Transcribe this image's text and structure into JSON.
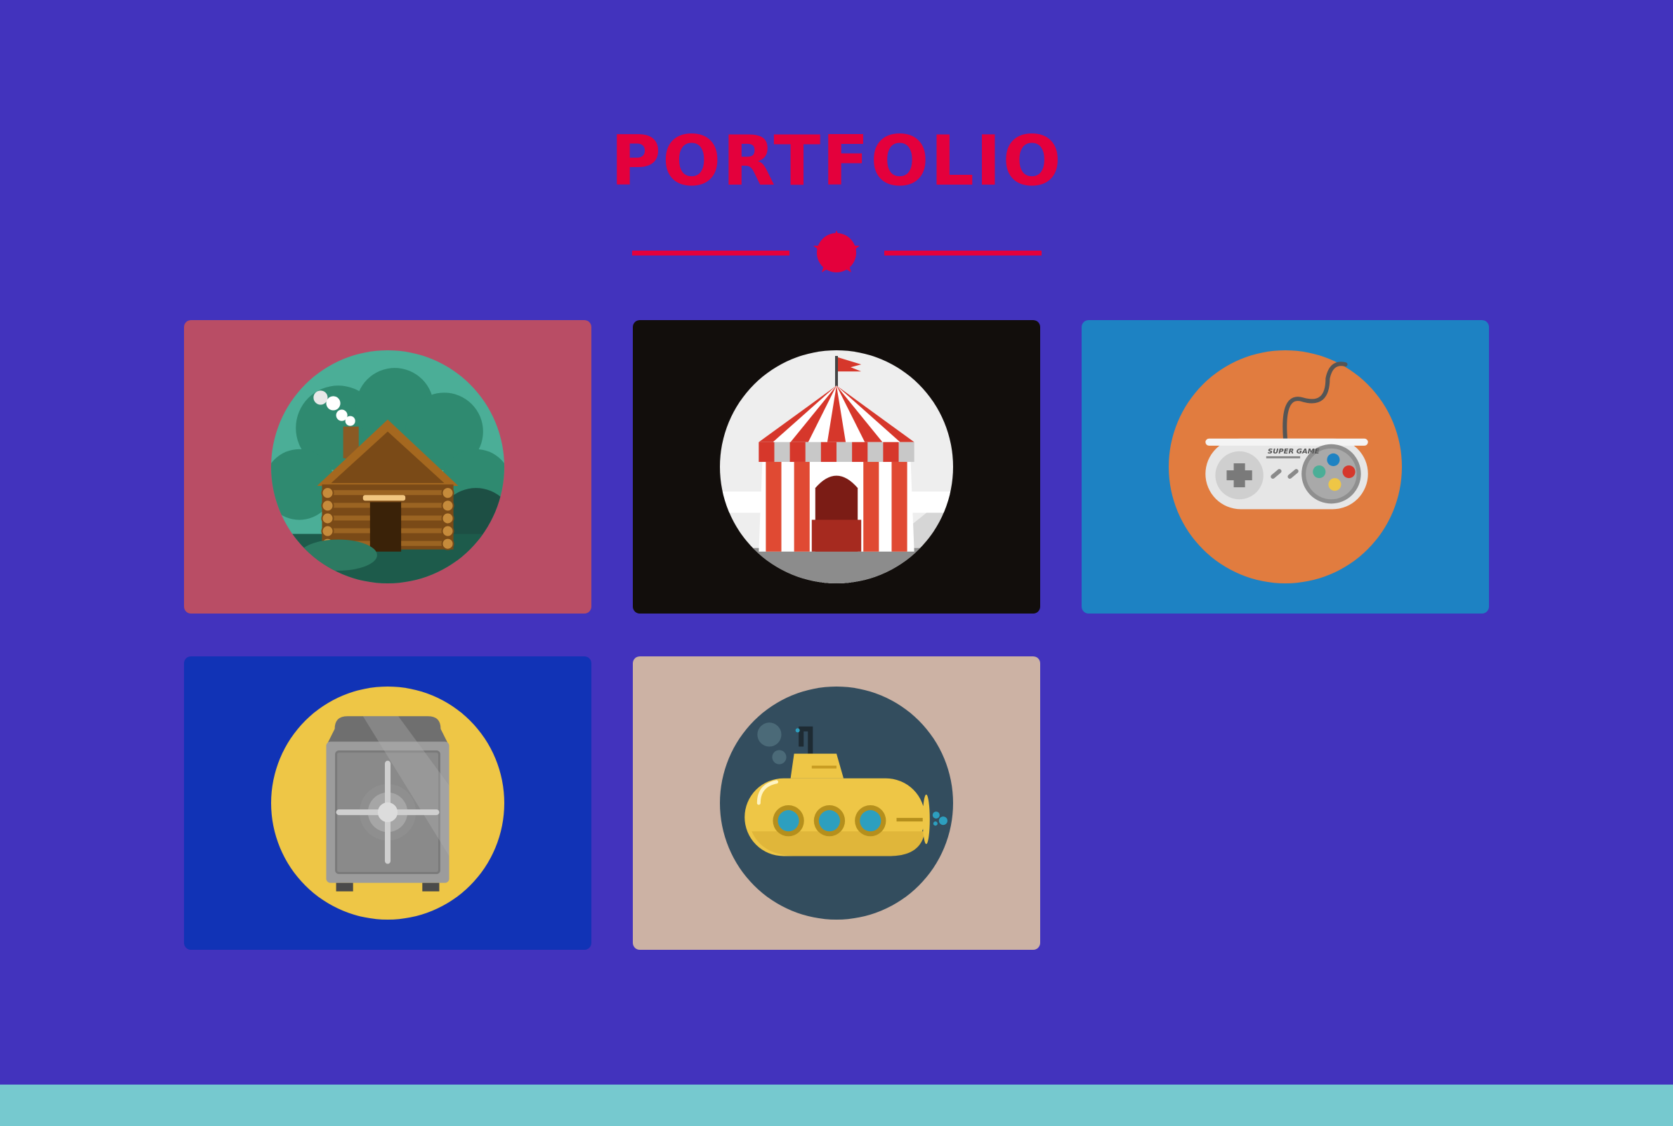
{
  "page": {
    "background": "#4233bd"
  },
  "header": {
    "title": "PORTFOLIO",
    "title_color": "#e4003c",
    "divider_icon": "star-icon"
  },
  "portfolio": {
    "items": [
      {
        "illustration": "log-cabin-icon",
        "background": "#b94d65",
        "circle": "#4bae97"
      },
      {
        "illustration": "circus-tent-icon",
        "background": "#120e0c",
        "circle": "#eeeeee"
      },
      {
        "illustration": "game-controller-icon",
        "background": "#1d82c3",
        "circle": "#e17c3f",
        "controller_text": "SUPER GAME"
      },
      {
        "illustration": "safe-icon",
        "background": "#1133b6",
        "circle": "#eec646"
      },
      {
        "illustration": "submarine-icon",
        "background": "#ccb2a4",
        "circle": "#334d5e"
      }
    ]
  },
  "footer": {
    "background": "#76c9cf"
  }
}
